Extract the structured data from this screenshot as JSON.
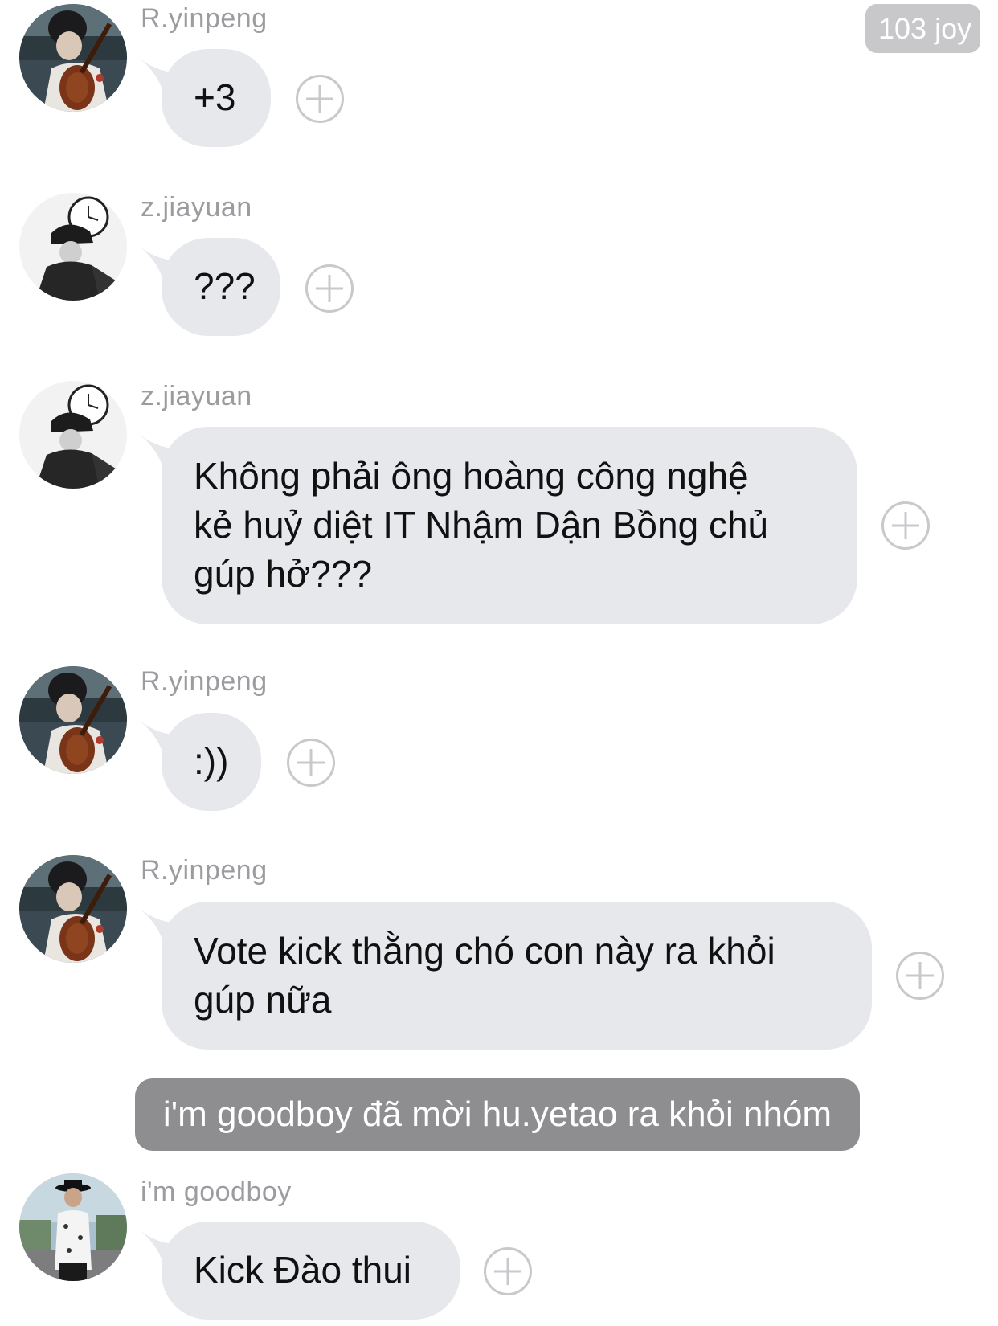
{
  "header": {
    "reaction_badge": "103 joy"
  },
  "messages": [
    {
      "sender": "R.yinpeng",
      "text": "+3",
      "avatar": "cello-player-avatar"
    },
    {
      "sender": "z.jiayuan",
      "text": "???",
      "avatar": "clock-hat-avatar"
    },
    {
      "sender": "z.jiayuan",
      "lines": [
        "Không phải ông hoàng công nghệ",
        "kẻ huỷ diệt IT Nhậm Dận Bồng chủ",
        "gúp hở???"
      ],
      "avatar": "clock-hat-avatar"
    },
    {
      "sender": "R.yinpeng",
      "text": ":))",
      "avatar": "cello-player-avatar"
    },
    {
      "sender": "R.yinpeng",
      "lines": [
        "Vote kick thằng chó con này ra khỏi",
        "gúp nữa"
      ],
      "avatar": "cello-player-avatar"
    },
    {
      "sender": "i'm goodboy",
      "text": "Kick Đào thui",
      "avatar": "hat-man-avatar"
    }
  ],
  "system_notice": "i'm goodboy đã mời hu.yetao ra khỏi nhóm",
  "icons": {
    "add_reaction": "plus-circle-icon"
  },
  "colors": {
    "bubble": "#e6e8ec",
    "system": "#8e8e90",
    "badge": "#c8c8cb",
    "sender": "#9c9ca0"
  }
}
